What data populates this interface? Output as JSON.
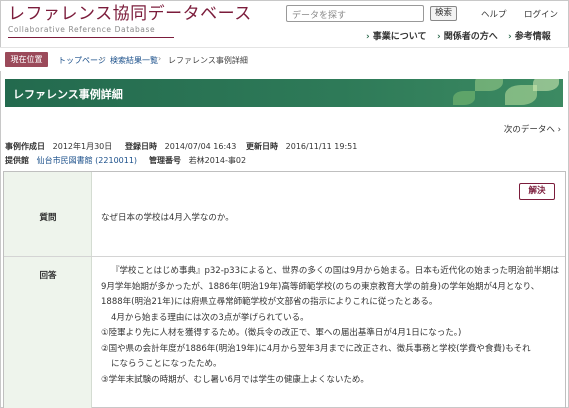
{
  "header": {
    "logo_title": "レファレンス協同データベース",
    "logo_subtitle": "Collaborative Reference Database",
    "search_placeholder": "データを探す",
    "search_button": "検索",
    "help": "ヘルプ",
    "login": "ログイン",
    "nav": [
      "事業について",
      "関係者の方へ",
      "参考情報"
    ]
  },
  "breadcrumb": {
    "here": "現在位置",
    "items": [
      "トップページ",
      "検索結果一覧",
      "レファレンス事例詳細"
    ]
  },
  "banner": {
    "title": "レファレンス事例詳細"
  },
  "pager": {
    "next": "次のデータへ ›"
  },
  "meta": {
    "created_label": "事例作成日",
    "created_value": "2012年1月30日",
    "registered_label": "登録日時",
    "registered_value": "2014/07/04 16:43",
    "updated_label": "更新日時",
    "updated_value": "2016/11/11 19:51",
    "provider_label": "提供館",
    "provider_value": "仙台市民図書館 (2210011)",
    "control_label": "管理番号",
    "control_value": "若林2014-事02"
  },
  "record": {
    "status": "解決",
    "question_label": "質問",
    "question": "なぜ日本の学校は4月入学なのか。",
    "answer_label": "回答",
    "answer_lines": [
      "『学校ことはじめ事典』p32-p33によると、世界の多くの国は9月から始まる。日本も近代化の始まった明治前半期は",
      "9月学年始期が多かったが、1886年(明治19年)高等師範学校(のちの東京教育大学の前身)の学年始期が4月となり、",
      "1888年(明治21年)には府県立尋常師範学校が文部省の指示によりこれに従ったとある。",
      "4月から始まる理由には次の3点が挙げられている。",
      "①陸軍より先に人材を獲得するため。(徴兵令の改正で、軍への届出基準日が4月1日になった。)",
      "②国や県の会計年度が1886年(明治19年)に4月から翌年3月までに改正され、徴兵事務と学校(学費や食費)もそれ",
      "にならうことになったため。",
      "③学年末試験の時期が、むし暑い6月では学生の健康上よくないため。"
    ]
  },
  "colors": {
    "brand": "#7b1c3b",
    "banner": "#2e7a58",
    "label_bg": "#eef4ec"
  }
}
